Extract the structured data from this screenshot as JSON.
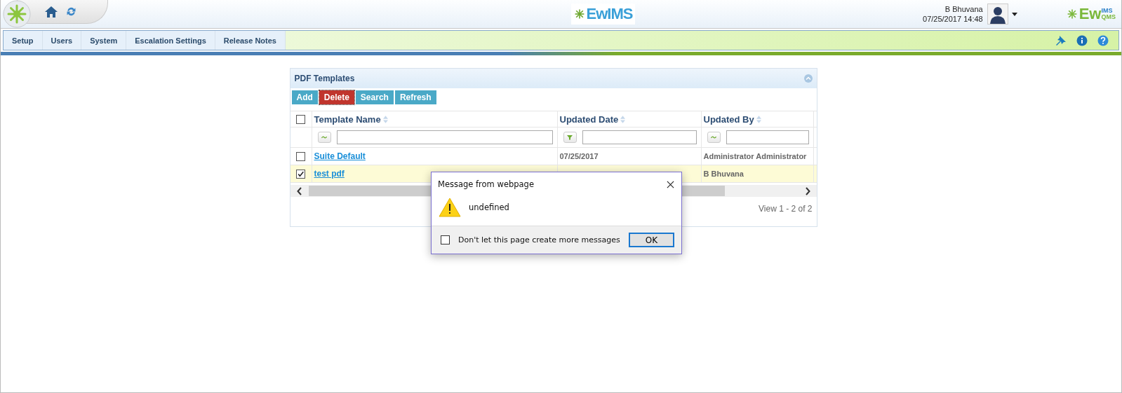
{
  "header": {
    "logo_text": "EwIMS",
    "user": {
      "name": "B Bhuvana",
      "datetime": "07/25/2017 14:48"
    },
    "brand": {
      "main": "Ew",
      "top": "IMS",
      "bottom": "QMS"
    }
  },
  "nav": {
    "items": [
      {
        "label": "Setup"
      },
      {
        "label": "Users"
      },
      {
        "label": "System"
      },
      {
        "label": "Escalation Settings"
      },
      {
        "label": "Release Notes"
      }
    ]
  },
  "panel": {
    "title": "PDF Templates",
    "buttons": [
      {
        "label": "Add",
        "kind": "normal"
      },
      {
        "label": "Delete",
        "kind": "danger"
      },
      {
        "label": "Search",
        "kind": "normal"
      },
      {
        "label": "Refresh",
        "kind": "normal"
      }
    ],
    "select_all": {
      "checked": false
    },
    "columns": [
      {
        "label": "Template Name",
        "kind": "contains"
      },
      {
        "label": "Updated Date",
        "kind": "funnel"
      },
      {
        "label": "Updated By",
        "kind": "contains"
      }
    ],
    "rows": [
      {
        "checked": false,
        "selected": false,
        "cells": [
          "Suite Default",
          "07/25/2017",
          "Administrator Administrator"
        ]
      },
      {
        "checked": true,
        "selected": true,
        "cells": [
          "test pdf",
          null,
          "B Bhuvana"
        ]
      }
    ],
    "pager": "View 1 - 2 of 2"
  },
  "dialog": {
    "title": "Message from webpage",
    "message": "undefined",
    "checkbox": {
      "label": "Don't let this page create more messages",
      "checked": false
    },
    "button": "OK"
  }
}
